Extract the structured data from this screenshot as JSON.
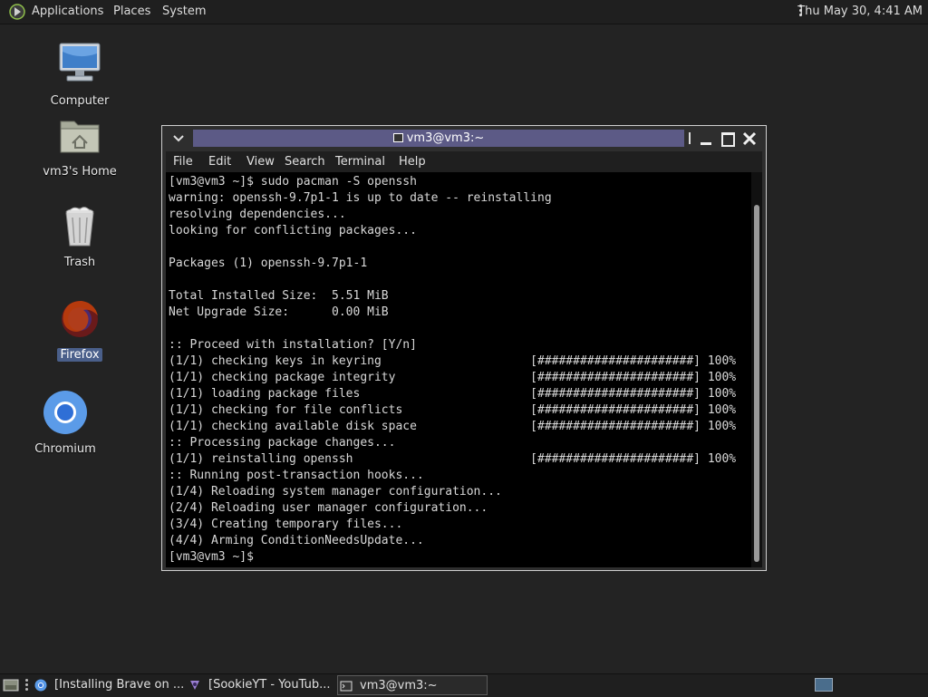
{
  "top_panel": {
    "menus": [
      "Applications",
      "Places",
      "System"
    ],
    "clock": "Thu May 30,  4:41 AM"
  },
  "desktop": {
    "icons": [
      {
        "label": "Computer",
        "icon": "computer-icon"
      },
      {
        "label": "vm3's Home",
        "icon": "home-folder-icon"
      },
      {
        "label": "Trash",
        "icon": "trash-icon"
      },
      {
        "label": "Firefox",
        "icon": "firefox-icon"
      },
      {
        "label": "Chromium",
        "icon": "chromium-icon"
      }
    ]
  },
  "terminal": {
    "title": "vm3@vm3:~",
    "menu": [
      "File",
      "Edit",
      "View",
      "Search",
      "Terminal",
      "Help"
    ],
    "lines": [
      "[vm3@vm3 ~]$ sudo pacman -S openssh",
      "warning: openssh-9.7p1-1 is up to date -- reinstalling",
      "resolving dependencies...",
      "looking for conflicting packages...",
      "",
      "Packages (1) openssh-9.7p1-1",
      "",
      "Total Installed Size:  5.51 MiB",
      "Net Upgrade Size:      0.00 MiB",
      "",
      ":: Proceed with installation? [Y/n]",
      "(1/1) checking keys in keyring                     [######################] 100%",
      "(1/1) checking package integrity                   [######################] 100%",
      "(1/1) loading package files                        [######################] 100%",
      "(1/1) checking for file conflicts                  [######################] 100%",
      "(1/1) checking available disk space                [######################] 100%",
      ":: Processing package changes...",
      "(1/1) reinstalling openssh                         [######################] 100%",
      ":: Running post-transaction hooks...",
      "(1/4) Reloading system manager configuration...",
      "(2/4) Reloading user manager configuration...",
      "(3/4) Creating temporary files...",
      "(4/4) Arming ConditionNeedsUpdate...",
      "[vm3@vm3 ~]$ "
    ]
  },
  "taskbar": {
    "tasks": [
      {
        "label": "[Installing Brave on ...",
        "icon": "chromium-icon"
      },
      {
        "label": "[SookieYT - YouTub...",
        "icon": "app-icon"
      },
      {
        "label": "vm3@vm3:~",
        "icon": "terminal-icon",
        "active": true
      }
    ]
  },
  "colors": {
    "desktop": "#232323",
    "title_active": "#5c5a86",
    "terminal_bg": "#000000",
    "terminal_fg": "#d8d8d8"
  }
}
